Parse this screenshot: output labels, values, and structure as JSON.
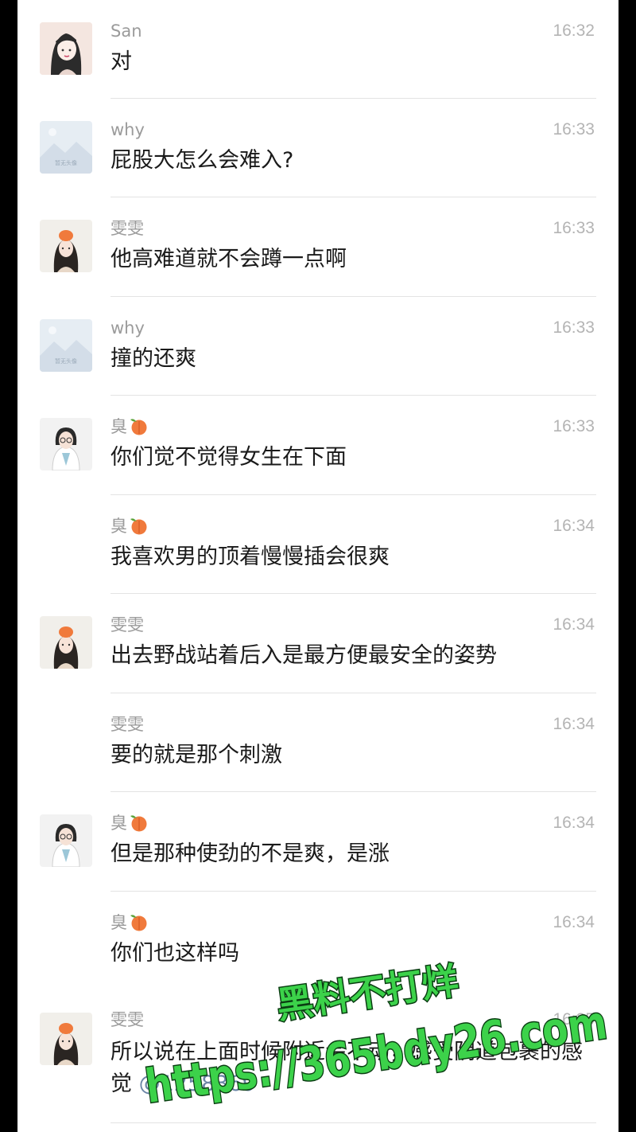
{
  "messages": [
    {
      "name": "San",
      "time": "16:32",
      "text": "对",
      "avatar": "girl-sketch",
      "show_avatar": true
    },
    {
      "name": "why",
      "time": "16:33",
      "text": "屁股大怎么会难入?",
      "avatar": "placeholder",
      "show_avatar": true
    },
    {
      "name": "雯雯",
      "time": "16:33",
      "text": "他高难道就不会蹲一点啊",
      "avatar": "girl-hat",
      "show_avatar": true
    },
    {
      "name": "why",
      "time": "16:33",
      "text": "撞的还爽",
      "avatar": "placeholder",
      "show_avatar": true
    },
    {
      "name": "臭",
      "time": "16:33",
      "text": "你们觉不觉得女生在下面",
      "avatar": "doctor",
      "show_avatar": true
    },
    {
      "name": "臭",
      "time": "16:34",
      "text": "我喜欢男的顶着慢慢插会很爽",
      "avatar": "doctor",
      "show_avatar": false
    },
    {
      "name": "雯雯",
      "time": "16:34",
      "text": "出去野战站着后入是最方便最安全的姿势",
      "avatar": "girl-hat",
      "show_avatar": true
    },
    {
      "name": "雯雯",
      "time": "16:34",
      "text": "要的就是那个刺激",
      "avatar": "girl-hat",
      "show_avatar": false
    },
    {
      "name": "臭",
      "time": "16:34",
      "text": "但是那种使劲的不是爽，是涨",
      "avatar": "doctor",
      "show_avatar": true
    },
    {
      "name": "臭",
      "time": "16:34",
      "text": "你们也这样吗",
      "avatar": "doctor",
      "show_avatar": false
    },
    {
      "name": "雯雯",
      "time": "16:35",
      "text": "所以说在上面时候附近会不动，感受阴道包裹的感觉 ",
      "mention": "@1258369",
      "avatar": "girl-hat",
      "show_avatar": true
    }
  ],
  "placeholder_caption": "暂无头像",
  "watermark": {
    "line1": "黑料不打烊",
    "line2": "https://365bdy26.com",
    "color_fill": "#3cd24a",
    "color_stroke": "#0a3d12"
  },
  "colors": {
    "background": "#ffffff",
    "name": "#9b9b9b",
    "time": "#b4b4b4",
    "mention": "#6b85a6",
    "peach": "#f07a3c"
  }
}
